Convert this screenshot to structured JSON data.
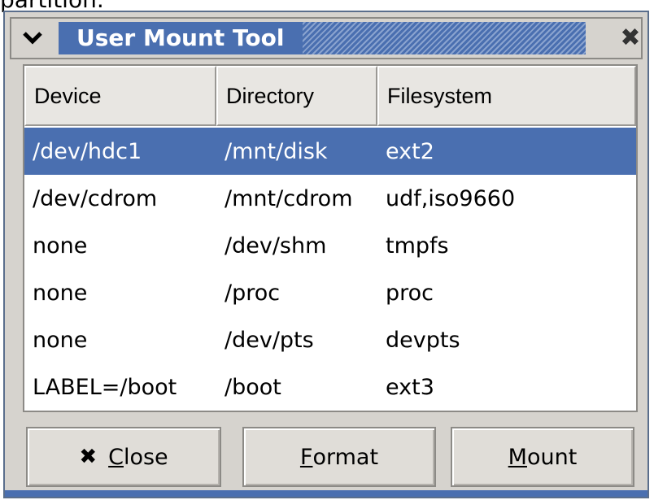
{
  "background_text": "partition.",
  "window": {
    "title": "User Mount Tool",
    "menu_icon": "chevron-down-icon",
    "close_icon": "close-icon",
    "close_glyph": "✖"
  },
  "table": {
    "headers": [
      "Device",
      "Directory",
      "Filesystem"
    ],
    "rows": [
      [
        "/dev/hdc1",
        "/mnt/disk",
        "ext2"
      ],
      [
        "/dev/cdrom",
        "/mnt/cdrom",
        "udf,iso9660"
      ],
      [
        "none",
        "/dev/shm",
        "tmpfs"
      ],
      [
        "none",
        "/proc",
        "proc"
      ],
      [
        "none",
        "/dev/pts",
        "devpts"
      ],
      [
        "LABEL=/boot",
        "/boot",
        "ext3"
      ]
    ],
    "selected_row": 0
  },
  "buttons": {
    "close": {
      "label_u": "C",
      "label_rest": "lose",
      "icon": "close-x-icon",
      "glyph": "✖"
    },
    "format": {
      "label_u": "F",
      "label_rest": "ormat"
    },
    "mount": {
      "label_u": "M",
      "label_rest": "ount"
    }
  },
  "colors": {
    "selection": "#4a6fb0",
    "titlebar": "#4a6fb0",
    "window_bg": "#d6d3ce"
  }
}
